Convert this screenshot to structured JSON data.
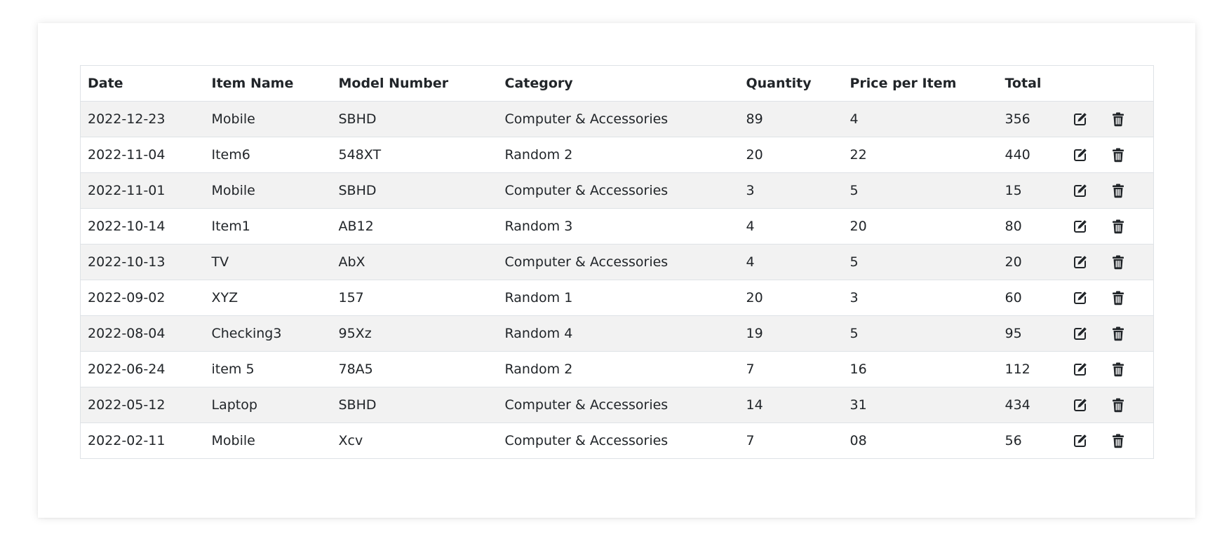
{
  "table": {
    "headers": {
      "date": "Date",
      "item_name": "Item Name",
      "model_number": "Model Number",
      "category": "Category",
      "quantity": "Quantity",
      "price_per_item": "Price per Item",
      "total": "Total",
      "actions": ""
    },
    "rows": [
      {
        "date": "2022-12-23",
        "item_name": "Mobile",
        "model_number": "SBHD",
        "category": "Computer & Accessories",
        "quantity": "89",
        "price_per_item": "4",
        "total": "356"
      },
      {
        "date": "2022-11-04",
        "item_name": "Item6",
        "model_number": "548XT",
        "category": "Random 2",
        "quantity": "20",
        "price_per_item": "22",
        "total": "440"
      },
      {
        "date": "2022-11-01",
        "item_name": "Mobile",
        "model_number": "SBHD",
        "category": "Computer & Accessories",
        "quantity": "3",
        "price_per_item": "5",
        "total": "15"
      },
      {
        "date": "2022-10-14",
        "item_name": "Item1",
        "model_number": "AB12",
        "category": "Random 3",
        "quantity": "4",
        "price_per_item": "20",
        "total": "80"
      },
      {
        "date": "2022-10-13",
        "item_name": "TV",
        "model_number": "AbX",
        "category": "Computer & Accessories",
        "quantity": "4",
        "price_per_item": "5",
        "total": "20"
      },
      {
        "date": "2022-09-02",
        "item_name": "XYZ",
        "model_number": "157",
        "category": "Random 1",
        "quantity": "20",
        "price_per_item": "3",
        "total": "60"
      },
      {
        "date": "2022-08-04",
        "item_name": "Checking3",
        "model_number": "95Xz",
        "category": "Random 4",
        "quantity": "19",
        "price_per_item": "5",
        "total": "95"
      },
      {
        "date": "2022-06-24",
        "item_name": "item 5",
        "model_number": "78A5",
        "category": "Random 2",
        "quantity": "7",
        "price_per_item": "16",
        "total": "112"
      },
      {
        "date": "2022-05-12",
        "item_name": "Laptop",
        "model_number": "SBHD",
        "category": "Computer & Accessories",
        "quantity": "14",
        "price_per_item": "31",
        "total": "434"
      },
      {
        "date": "2022-02-11",
        "item_name": "Mobile",
        "model_number": "Xcv",
        "category": "Computer & Accessories",
        "quantity": "7",
        "price_per_item": "08",
        "total": "56"
      }
    ],
    "row_actions": [
      {
        "icon": "edit-icon"
      },
      {
        "icon": "trash-icon"
      }
    ]
  },
  "colors": {
    "stripe": "#f2f2f2",
    "border": "#dee2e6",
    "text": "#212529"
  }
}
